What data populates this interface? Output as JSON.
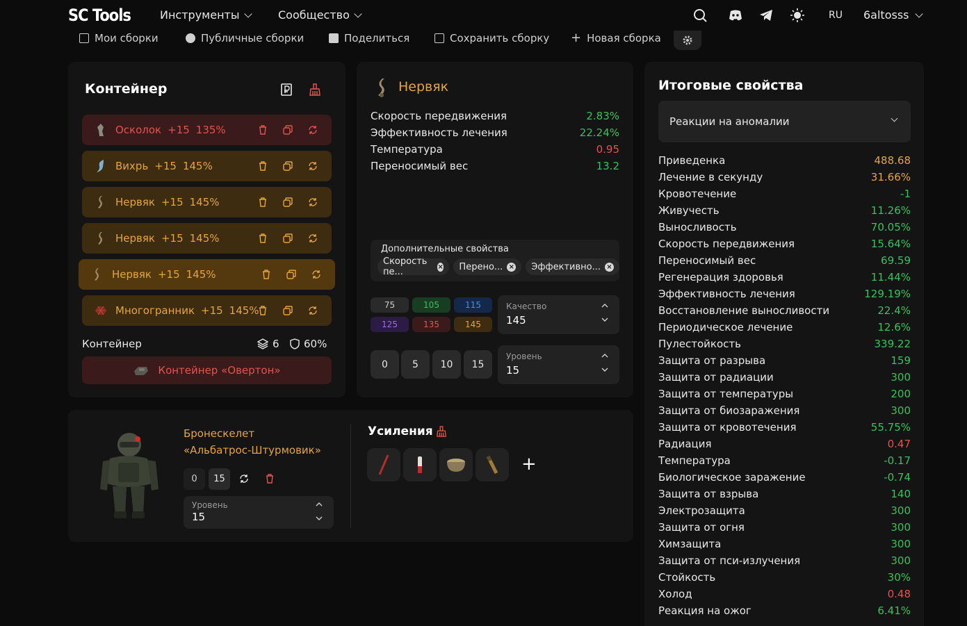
{
  "header": {
    "logo": "SC Tools",
    "nav": [
      {
        "label": "Инструменты"
      },
      {
        "label": "Сообщество"
      }
    ],
    "lang": "RU",
    "user": "6altosss"
  },
  "subbar": {
    "items": [
      {
        "label": "Мои сборки",
        "icon": "grid-icon"
      },
      {
        "label": "Публичные сборки",
        "icon": "globe-icon"
      },
      {
        "label": "Поделиться",
        "icon": "image-icon"
      },
      {
        "label": "Сохранить сборку",
        "icon": "save-icon"
      },
      {
        "label": "Новая сборка",
        "icon": "plus-icon"
      }
    ]
  },
  "container_panel": {
    "title": "Контейнер",
    "artifacts": [
      {
        "name": "Осколок",
        "plus": "+15",
        "quality": "135%",
        "style": "red"
      },
      {
        "name": "Вихрь",
        "plus": "+15",
        "quality": "145%",
        "style": "gold"
      },
      {
        "name": "Нервяк",
        "plus": "+15",
        "quality": "145%",
        "style": "gold"
      },
      {
        "name": "Нервяк",
        "plus": "+15",
        "quality": "145%",
        "style": "gold"
      },
      {
        "name": "Нервяк",
        "plus": "+15",
        "quality": "145%",
        "style": "gold-hi"
      },
      {
        "name": "Многогранник",
        "plus": "+15",
        "quality": "145%",
        "style": "gold"
      }
    ],
    "footer_label": "Контейнер",
    "slots": "6",
    "protection": "60%",
    "container_name": "Контейнер «Овертон»"
  },
  "artifact_panel": {
    "name": "Нервяк",
    "stats": [
      {
        "label": "Скорость передвижения",
        "value": "2.83%",
        "color": "green"
      },
      {
        "label": "Эффективность лечения",
        "value": "22.24%",
        "color": "green"
      },
      {
        "label": "Температура",
        "value": "0.95",
        "color": "red"
      },
      {
        "label": "Переносимый вес",
        "value": "13.2",
        "color": "green"
      }
    ],
    "extra_title": "Дополнительные свойства",
    "extra_chips": [
      "Скорость пе...",
      "Перено...",
      "Эффективно..."
    ],
    "quality_buttons": [
      {
        "label": "75",
        "bg": "#2a2a2a",
        "fg": "#cfcfcf"
      },
      {
        "label": "105",
        "bg": "#173d22",
        "fg": "#36c35b"
      },
      {
        "label": "115",
        "bg": "#14284a",
        "fg": "#4c8de0"
      },
      {
        "label": "125",
        "bg": "#2c1b45",
        "fg": "#9c6ee0"
      },
      {
        "label": "135",
        "bg": "#3a1a1a",
        "fg": "#e0554d"
      },
      {
        "label": "145",
        "bg": "#3d2c0f",
        "fg": "#e6a53a"
      }
    ],
    "quality_label": "Качество",
    "quality_value": "145",
    "level_buttons": [
      "0",
      "5",
      "10",
      "15"
    ],
    "level_label": "Уровень",
    "level_value": "15"
  },
  "armor_panel": {
    "name_line1": "Бронескелет",
    "name_line2": "«Альбатрос-Штурмовик»",
    "upgrade_buttons": [
      "0",
      "15"
    ],
    "level_label": "Уровень",
    "level_value": "15",
    "boosts_title": "Усиления"
  },
  "totals_panel": {
    "title": "Итоговые свойства",
    "dropdown": "Реакции на аномалии",
    "stats": [
      {
        "label": "Приведенка",
        "value": "488.68",
        "color": "gold"
      },
      {
        "label": "Лечение в секунду",
        "value": "31.66%",
        "color": "gold"
      },
      {
        "label": "Кровотечение",
        "value": "-1",
        "color": "green"
      },
      {
        "label": "Живучесть",
        "value": "11.26%",
        "color": "green"
      },
      {
        "label": "Выносливость",
        "value": "70.05%",
        "color": "green"
      },
      {
        "label": "Скорость передвижения",
        "value": "15.64%",
        "color": "green"
      },
      {
        "label": "Переносимый вес",
        "value": "69.59",
        "color": "green"
      },
      {
        "label": "Регенерация здоровья",
        "value": "11.44%",
        "color": "green"
      },
      {
        "label": "Эффективность лечения",
        "value": "129.19%",
        "color": "green"
      },
      {
        "label": "Восстановление выносливости",
        "value": "22.4%",
        "color": "green"
      },
      {
        "label": "Периодическое лечение",
        "value": "12.6%",
        "color": "green"
      },
      {
        "label": "Пулестойкость",
        "value": "339.22",
        "color": "green"
      },
      {
        "label": "Защита от разрыва",
        "value": "159",
        "color": "green"
      },
      {
        "label": "Защита от радиации",
        "value": "300",
        "color": "green"
      },
      {
        "label": "Защита от температуры",
        "value": "200",
        "color": "green"
      },
      {
        "label": "Защита от биозаражения",
        "value": "300",
        "color": "green"
      },
      {
        "label": "Защита от кровотечения",
        "value": "55.75%",
        "color": "green"
      },
      {
        "label": "Радиация",
        "value": "0.47",
        "color": "red"
      },
      {
        "label": "Температура",
        "value": "-0.17",
        "color": "green"
      },
      {
        "label": "Биологическое заражение",
        "value": "-0.74",
        "color": "green"
      },
      {
        "label": "Защита от взрыва",
        "value": "140",
        "color": "green"
      },
      {
        "label": "Электрозащита",
        "value": "300",
        "color": "green"
      },
      {
        "label": "Защита от огня",
        "value": "300",
        "color": "green"
      },
      {
        "label": "Химзащита",
        "value": "300",
        "color": "green"
      },
      {
        "label": "Защита от пси-излучения",
        "value": "300",
        "color": "green"
      },
      {
        "label": "Стойкость",
        "value": "30%",
        "color": "green"
      },
      {
        "label": "Холод",
        "value": "0.48",
        "color": "red"
      },
      {
        "label": "Реакция на ожог",
        "value": "6.41%",
        "color": "green"
      }
    ]
  }
}
